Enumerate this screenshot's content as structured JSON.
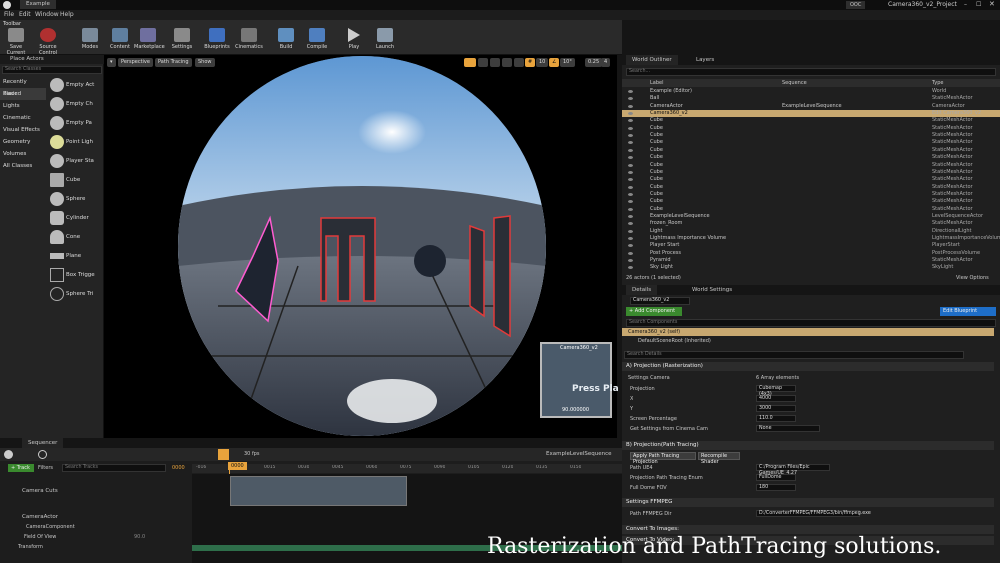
{
  "window": {
    "tab": "Example",
    "project": "Camera360_v2_Project",
    "source_control": "OOC"
  },
  "menu": [
    "File",
    "Edit",
    "Window",
    "Help"
  ],
  "toolbar": {
    "tab_label": "Toolbar",
    "buttons": [
      "Save Current",
      "Source Control",
      "Modes",
      "Content",
      "Marketplace",
      "Settings",
      "Blueprints",
      "Cinematics",
      "Build",
      "Compile",
      "Play",
      "Launch"
    ]
  },
  "place_actors": {
    "tab": "Place Actors",
    "search_placeholder": "Search Classes",
    "categories": [
      "Recently Placed",
      "Basic",
      "Lights",
      "Cinematic",
      "Visual Effects",
      "Geometry",
      "Volumes",
      "All Classes"
    ],
    "actors": [
      "Empty Act",
      "Empty Ch",
      "Empty Pa",
      "Point Ligh",
      "Player Sta",
      "Cube",
      "Sphere",
      "Cylinder",
      "Cone",
      "Plane",
      "Box Trigge",
      "Sphere Tri"
    ]
  },
  "viewport": {
    "view_mode": "Perspective",
    "render_mode": "Path Tracing",
    "show_label": "Show",
    "grid": "10",
    "angle": "10°",
    "scale": "0.25",
    "speed": "4",
    "preview_title": "Camera360_v2",
    "preview_text": "Press Pla",
    "preview_value": "90.000000"
  },
  "outliner": {
    "tab": "World Outliner",
    "tab2": "Layers",
    "search_placeholder": "Search...",
    "columns": [
      "Label",
      "Sequence",
      "Type"
    ],
    "rows": [
      {
        "label": "Example (Editor)",
        "seq": "",
        "type": "World"
      },
      {
        "label": "Ball",
        "seq": "",
        "type": "StaticMeshActor"
      },
      {
        "label": "CameraActor",
        "seq": "ExampleLevelSequence",
        "type": "CameraActor"
      },
      {
        "label": "Camera360_v2",
        "seq": "",
        "type": "Edit Camera360_v2"
      },
      {
        "label": "Cube",
        "seq": "",
        "type": "StaticMeshActor"
      },
      {
        "label": "Cube",
        "seq": "",
        "type": "StaticMeshActor"
      },
      {
        "label": "Cube",
        "seq": "",
        "type": "StaticMeshActor"
      },
      {
        "label": "Cube",
        "seq": "",
        "type": "StaticMeshActor"
      },
      {
        "label": "Cube",
        "seq": "",
        "type": "StaticMeshActor"
      },
      {
        "label": "Cube",
        "seq": "",
        "type": "StaticMeshActor"
      },
      {
        "label": "Cube",
        "seq": "",
        "type": "StaticMeshActor"
      },
      {
        "label": "Cube",
        "seq": "",
        "type": "StaticMeshActor"
      },
      {
        "label": "Cube",
        "seq": "",
        "type": "StaticMeshActor"
      },
      {
        "label": "Cube",
        "seq": "",
        "type": "StaticMeshActor"
      },
      {
        "label": "Cube",
        "seq": "",
        "type": "StaticMeshActor"
      },
      {
        "label": "Cube",
        "seq": "",
        "type": "StaticMeshActor"
      },
      {
        "label": "Cube",
        "seq": "",
        "type": "StaticMeshActor"
      },
      {
        "label": "ExampleLevelSequence",
        "seq": "",
        "type": "LevelSequenceActor"
      },
      {
        "label": "frozen_Room",
        "seq": "",
        "type": "StaticMeshActor"
      },
      {
        "label": "Light",
        "seq": "",
        "type": "DirectionalLight"
      },
      {
        "label": "Lightmass Importance Volume",
        "seq": "",
        "type": "LightmassImportanceVolum"
      },
      {
        "label": "Player Start",
        "seq": "",
        "type": "PlayerStart"
      },
      {
        "label": "Post Process",
        "seq": "",
        "type": "PostProcessVolume"
      },
      {
        "label": "Pyramid",
        "seq": "",
        "type": "StaticMeshActor"
      },
      {
        "label": "Sky Light",
        "seq": "",
        "type": "SkyLight"
      }
    ],
    "status": "26 actors (1 selected)",
    "view_options": "View Options"
  },
  "details": {
    "tab": "Details",
    "tab2": "World Settings",
    "name_value": "Camera360_v2",
    "add_component": "+ Add Component",
    "edit_blueprint": "Edit Blueprint",
    "search_components": "Search Components",
    "self_row": "Camera360_v2 (self)",
    "root_row": "DefaultSceneRoot (Inherited)",
    "search_details": "Search Details",
    "sec_a": "A) Projection (Rasterization)",
    "settings_camera": "Settings Camera",
    "array_elements": "6 Array elements",
    "projection_label": "Projection",
    "projection_value": "Cubemap (4x3)",
    "x_label": "X",
    "x_value": "4000",
    "y_label": "Y",
    "y_value": "3000",
    "screen_pct_label": "Screen Percentage",
    "screen_pct_value": "110.0",
    "get_settings_label": "Get Settings from Cinema Cam",
    "get_settings_value": "None",
    "sec_b": "B) Projection(Path Tracing)",
    "apply_pt": "Apply Path Tracing Projection",
    "recompile": "Recompile Shader",
    "path_ue4_label": "Path UE4",
    "path_ue4_value": "C:/Program Files/Epic Games/UE_4.27",
    "pt_enum_label": "Projection Path Tracing Enum",
    "pt_enum_value": "FullDome",
    "fov_label": "Full Dome FOV",
    "fov_value": "180",
    "sec_c": "Settings FFMPEG",
    "ffmpeg_label": "Path FFMPEG Dir",
    "ffmpeg_value": "D:/ConverterFFMPEG/FFMPEG3/bin/ffmpeg.exe",
    "convert_images": "Convert To Images:",
    "convert_video": "Convert To Video:"
  },
  "sequencer": {
    "tab": "Sequencer",
    "fps": "30 fps",
    "sequence_name": "ExampleLevelSequence",
    "track_button": "+ Track",
    "filters": "Filters",
    "search_placeholder": "Search Tracks",
    "frame_field": "0000",
    "playhead": "0000",
    "ruler": [
      "-016",
      "0000",
      "0015",
      "0030",
      "0045",
      "0060",
      "0075",
      "0090",
      "0105",
      "0120",
      "0135",
      "0150"
    ],
    "tracks": [
      "Camera Cuts",
      "CameraActor",
      "CameraComponent",
      "Field Of View",
      "Transform"
    ],
    "fov_value": "90.0"
  },
  "caption": "Rasterization and PathTracing solutions.",
  "colors": {
    "accent_orange": "#e8a33c",
    "selection": "#c8a870",
    "add_green": "#3a8a2e",
    "blueprint_blue": "#1e6ec8"
  }
}
